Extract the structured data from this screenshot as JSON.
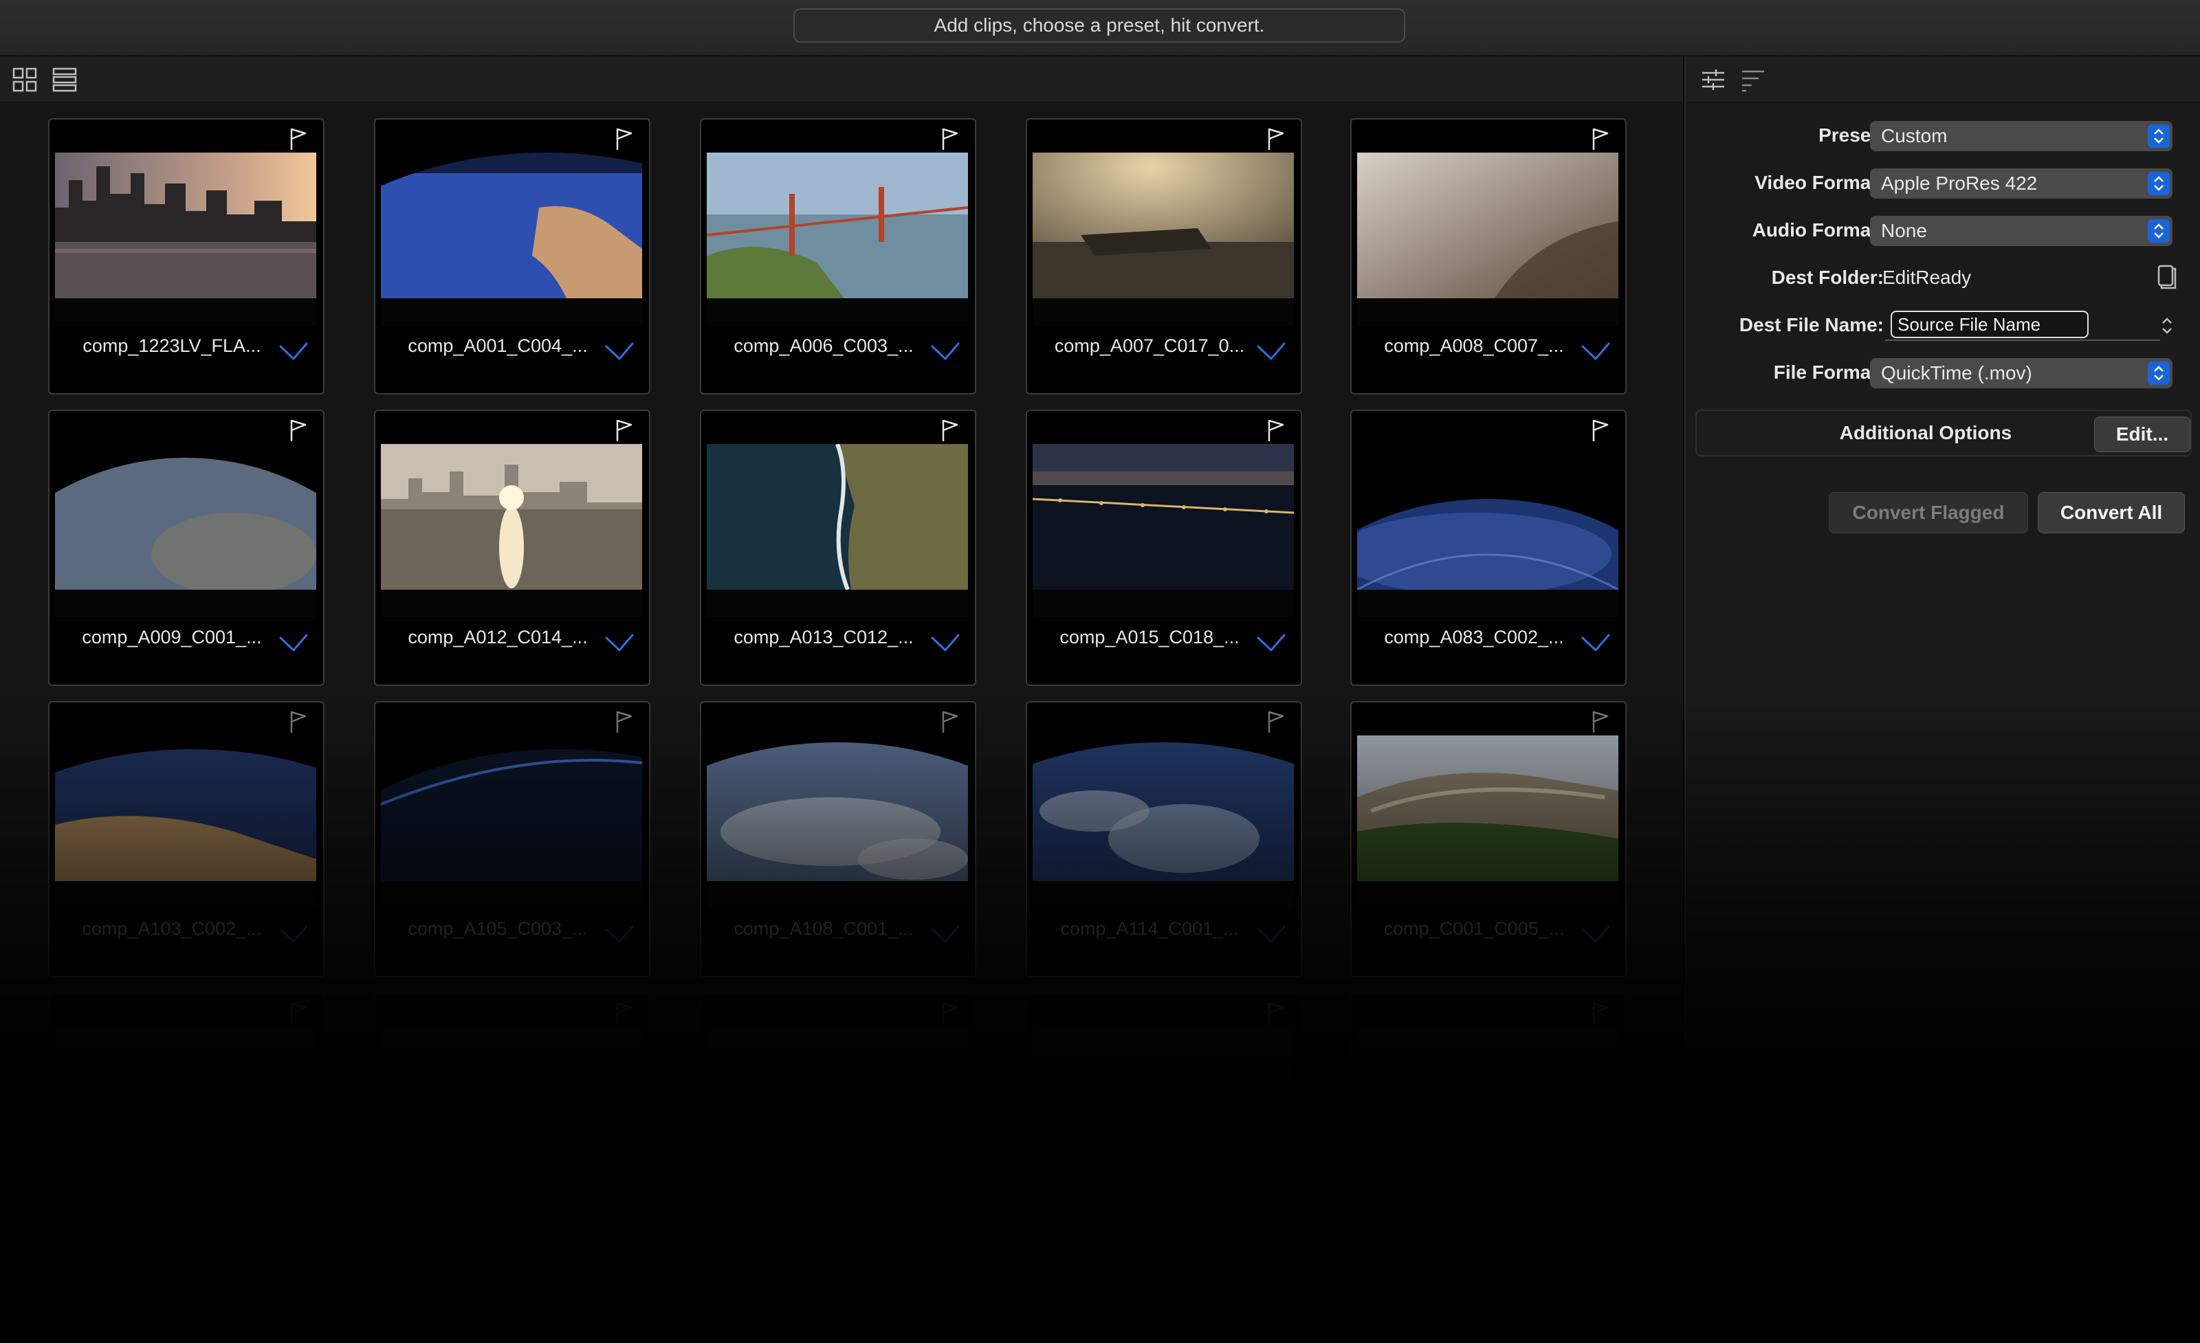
{
  "titlebar": {
    "status": "Add clips, choose a preset, hit convert."
  },
  "toolbar": {
    "grid_icon": "grid-view-icon",
    "list_icon": "list-view-icon",
    "settings_icon": "sliders-icon",
    "sort_icon": "sort-icon"
  },
  "clips": [
    {
      "name": "comp_1223LV_FLA...",
      "scene": "city-sunset"
    },
    {
      "name": "comp_A001_C004_...",
      "scene": "earth-blue"
    },
    {
      "name": "comp_A006_C003_...",
      "scene": "bridge-day"
    },
    {
      "name": "comp_A007_C017_0...",
      "scene": "bay-haze"
    },
    {
      "name": "comp_A008_C007_...",
      "scene": "fog"
    },
    {
      "name": "comp_A009_C001_...",
      "scene": "earth-curve"
    },
    {
      "name": "comp_A012_C014_...",
      "scene": "sun-water"
    },
    {
      "name": "comp_A013_C012_...",
      "scene": "coast"
    },
    {
      "name": "comp_A015_C018_...",
      "scene": "bridge-night"
    },
    {
      "name": "comp_A083_C002_...",
      "scene": "earth-dark"
    },
    {
      "name": "comp_A103_C002_...",
      "scene": "earth-desert"
    },
    {
      "name": "comp_A105_C003_...",
      "scene": "earth-night"
    },
    {
      "name": "comp_A108_C001_...",
      "scene": "earth-clouds"
    },
    {
      "name": "comp_A114_C001_...",
      "scene": "earth-ocean"
    },
    {
      "name": "comp_C001_C005_...",
      "scene": "great-wall"
    }
  ],
  "settings": {
    "preset": {
      "label": "Preset:",
      "value": "Custom"
    },
    "video_format": {
      "label": "Video Format:",
      "value": "Apple ProRes 422"
    },
    "audio_format": {
      "label": "Audio Format:",
      "value": "None"
    },
    "dest_folder": {
      "label": "Dest Folder:",
      "value": "EditReady"
    },
    "dest_file_name": {
      "label": "Dest File Name:",
      "value": "Source File Name"
    },
    "file_format": {
      "label": "File Format:",
      "value": "QuickTime (.mov)"
    }
  },
  "additional_options": {
    "label": "Additional Options",
    "edit_label": "Edit..."
  },
  "actions": {
    "convert_flagged": "Convert Flagged",
    "convert_all": "Convert All"
  },
  "colors": {
    "accent": "#1a64d8",
    "check": "#2f6fe0"
  }
}
